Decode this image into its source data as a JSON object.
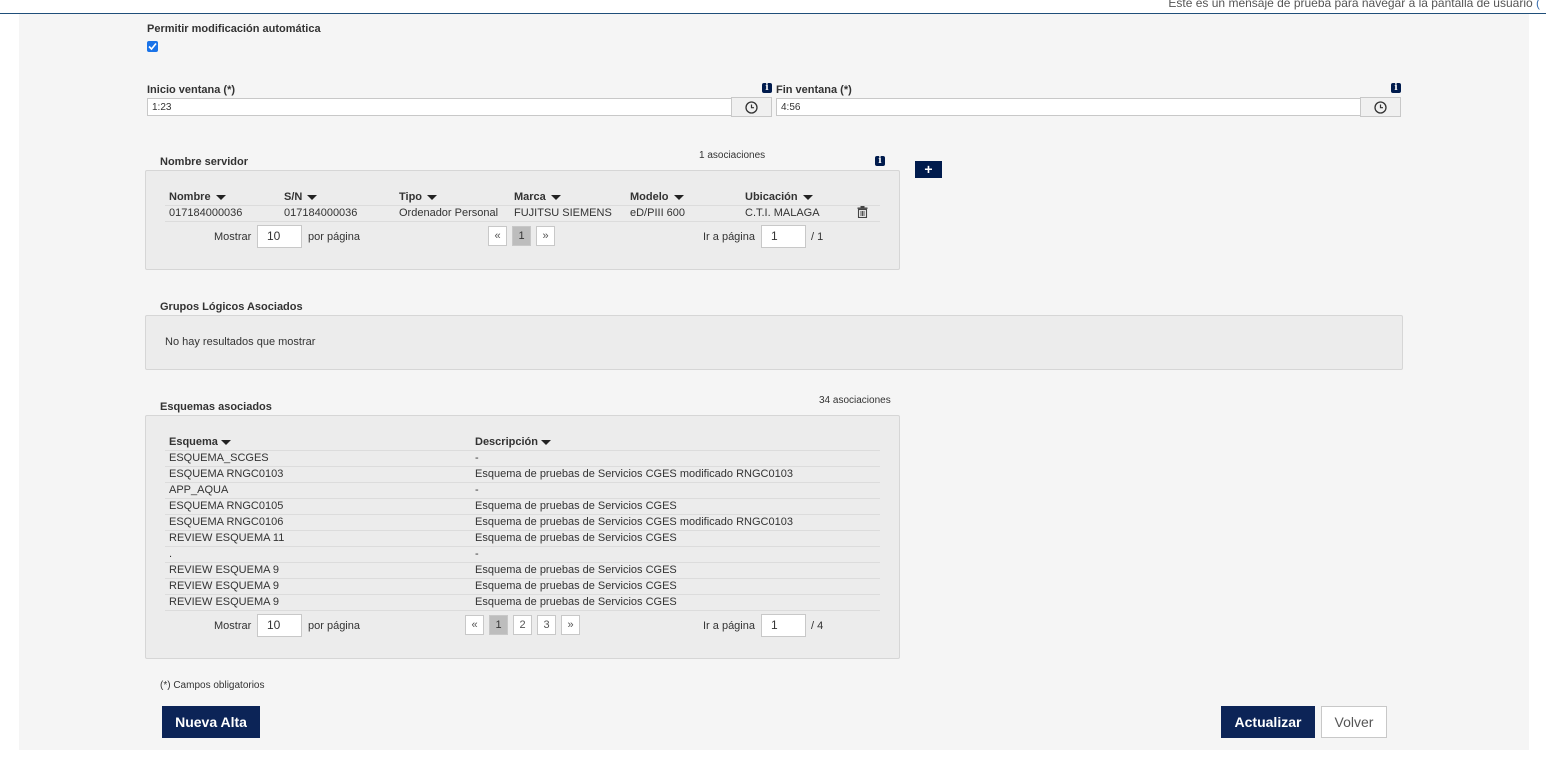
{
  "top_message": {
    "text": "Este es un mensaje de prueba para navegar a la pantalla de usuario",
    "tail": "("
  },
  "auto_modify": {
    "label": "Permitir modificación automática",
    "checked": true
  },
  "window_start": {
    "label": "Inicio ventana (*)",
    "value": "1:23"
  },
  "window_end": {
    "label": "Fin ventana (*)",
    "value": "4:56"
  },
  "servers": {
    "title": "Nombre servidor",
    "count": "1 asociaciones",
    "add_label": "+",
    "headers": [
      "Nombre",
      "S/N",
      "Tipo",
      "Marca",
      "Modelo",
      "Ubicación"
    ],
    "rows": [
      [
        "017184000036",
        "017184000036",
        "Ordenador Personal",
        "FUJITSU SIEMENS",
        "eD/PIII 600",
        "C.T.I. MALAGA"
      ]
    ],
    "pager": {
      "show_label": "Mostrar",
      "per_page": "10",
      "per_page_label": "por página",
      "prev": "«",
      "pages": [
        "1"
      ],
      "next": "»",
      "current": "1",
      "goto_label": "Ir a página",
      "goto_value": "1",
      "total": "/ 1"
    }
  },
  "logical_groups": {
    "title": "Grupos Lógicos Asociados",
    "empty": "No hay resultados que mostrar"
  },
  "schemes": {
    "title": "Esquemas asociados",
    "count": "34 asociaciones",
    "headers": [
      "Esquema",
      "Descripción"
    ],
    "rows": [
      [
        "ESQUEMA_SCGES",
        "-"
      ],
      [
        "ESQUEMA RNGC0103",
        "Esquema de pruebas de Servicios CGES modificado RNGC0103"
      ],
      [
        "APP_AQUA",
        "-"
      ],
      [
        "ESQUEMA RNGC0105",
        "Esquema de pruebas de Servicios CGES"
      ],
      [
        "ESQUEMA RNGC0106",
        "Esquema de pruebas de Servicios CGES modificado RNGC0103"
      ],
      [
        "REVIEW ESQUEMA 11",
        "Esquema de pruebas de Servicios CGES"
      ],
      [
        ".",
        "-"
      ],
      [
        "REVIEW ESQUEMA 9",
        "Esquema de pruebas de Servicios CGES"
      ],
      [
        "REVIEW ESQUEMA 9",
        "Esquema de pruebas de Servicios CGES"
      ],
      [
        "REVIEW ESQUEMA 9",
        "Esquema de pruebas de Servicios CGES"
      ]
    ],
    "pager": {
      "show_label": "Mostrar",
      "per_page": "10",
      "per_page_label": "por página",
      "prev": "«",
      "pages": [
        "1",
        "2",
        "3"
      ],
      "next": "»",
      "current": "1",
      "goto_label": "Ir a página",
      "goto_value": "1",
      "total": "/ 4"
    }
  },
  "required_note": "(*) Campos obligatorios",
  "buttons": {
    "new": "Nueva Alta",
    "update": "Actualizar",
    "back": "Volver"
  },
  "colors": {
    "primary": "#0c2457",
    "checkbox": "#1a73e8",
    "panel": "#f5f5f5"
  }
}
